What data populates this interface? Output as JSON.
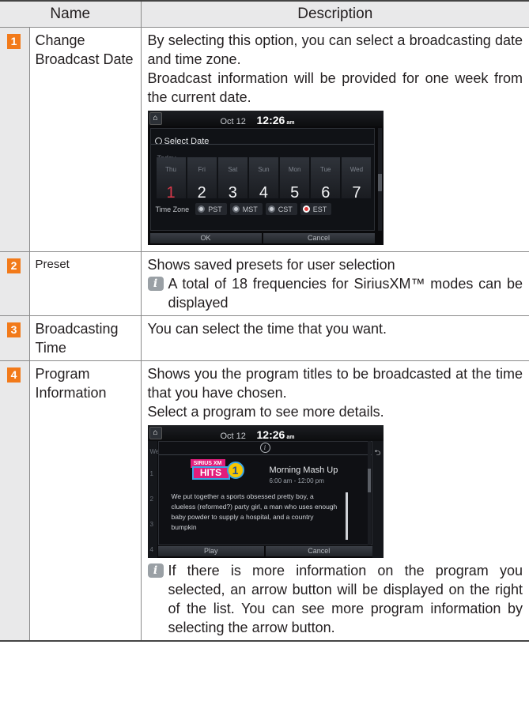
{
  "header": {
    "name": "Name",
    "description": "Description"
  },
  "rows": [
    {
      "num": "1",
      "name": "Change Broadcast Date",
      "desc": [
        "By selecting this option, you can select a broadcasting date and time zone.",
        "Broadcast information will be provided for one week from the current date."
      ]
    },
    {
      "num": "2",
      "name": "Preset",
      "desc": [
        "Shows saved presets for user selection"
      ],
      "note": "A total of 18 frequencies for SiriusXM™ modes can be displayed"
    },
    {
      "num": "3",
      "name": "Broadcasting Time",
      "desc": [
        "You can select the time that you want."
      ]
    },
    {
      "num": "4",
      "name": "Program Information",
      "desc": [
        "Shows you the program titles to be broadcasted at the time that you have chosen.",
        "Select a program to see more details."
      ],
      "note": "If there is more information on the program you selected, an arrow button will be displayed on the right of the list. You can see more program information by selecting the arrow button."
    }
  ],
  "screen1": {
    "home_icon": "home-icon",
    "date": "Oct 12",
    "time": "12:26",
    "ampm": "am",
    "title": "Select Date",
    "today": "Today",
    "days": [
      {
        "name": "Thu",
        "num": "1",
        "selected": true
      },
      {
        "name": "Fri",
        "num": "2"
      },
      {
        "name": "Sat",
        "num": "3"
      },
      {
        "name": "Sun",
        "num": "4"
      },
      {
        "name": "Mon",
        "num": "5"
      },
      {
        "name": "Tue",
        "num": "6"
      },
      {
        "name": "Wed",
        "num": "7"
      }
    ],
    "time_zone_label": "Time Zone",
    "zones": [
      "PST",
      "MST",
      "CST",
      "EST"
    ],
    "selected_zone": "EST",
    "ok": "OK",
    "cancel": "Cancel"
  },
  "screen2": {
    "date": "Oct 12",
    "time": "12:26",
    "ampm": "am",
    "logo_top": "SIRIUS XM",
    "logo_hits": "HITS",
    "logo_one": "1",
    "program_title": "Morning Mash Up",
    "program_time": "6:00 am - 12:00 pm",
    "program_text": "We put together a sports obsessed pretty boy, a clueless (reformed?) party girl, a man who uses enough baby powder to supply a hospital, and a country bumpkin",
    "side_labels": [
      "We",
      "1",
      "2",
      "3",
      "4"
    ],
    "play": "Play",
    "cancel": "Cancel"
  },
  "colors": {
    "badge": "#f27a1a",
    "header_bg": "#e9e9ea",
    "selected_day": "#d9384a"
  }
}
